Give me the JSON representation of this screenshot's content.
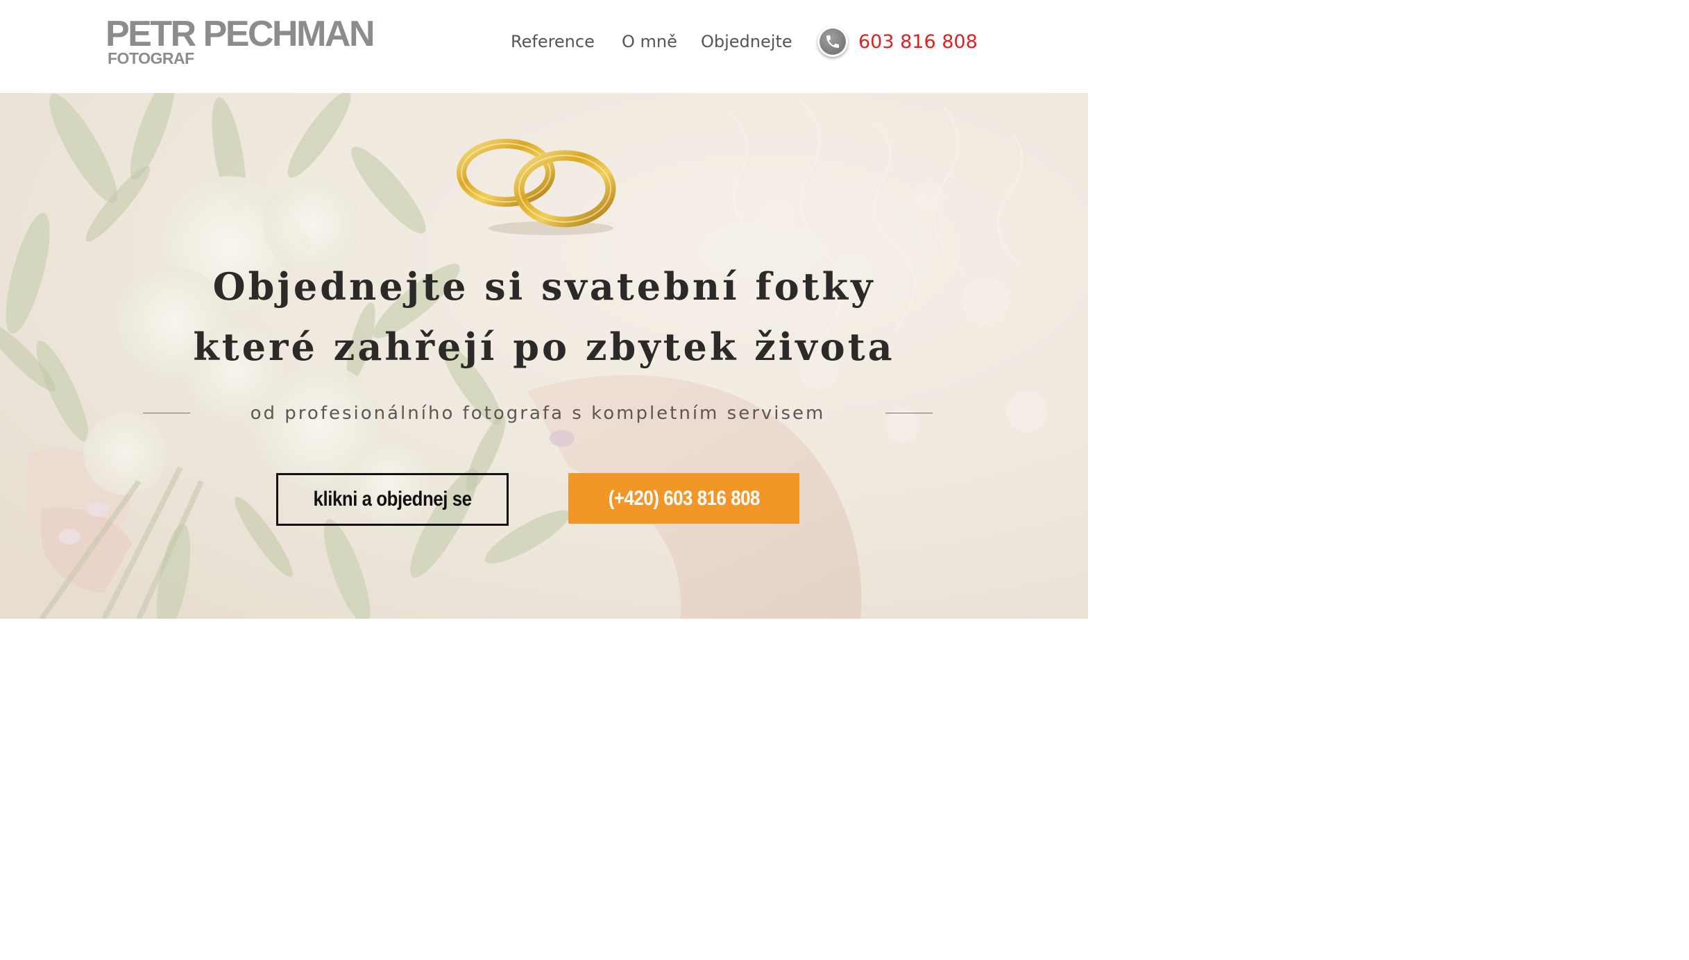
{
  "logo": {
    "name": "PETR PECHMAN",
    "subtitle": "FOTOGRAF"
  },
  "nav": {
    "items": [
      {
        "label": "Reference"
      },
      {
        "label": "O mně"
      },
      {
        "label": "Objednejte"
      }
    ],
    "phone_icon": "phone-icon",
    "phone": "603 816 808"
  },
  "hero": {
    "headline_line1": "Objednejte si svatební fotky",
    "headline_line2": "které zahřejí po zbytek života",
    "subheadline": "od profesionálního fotografa s kompletním servisem",
    "cta_button": "klikni a objednej se",
    "phone_button": "(+420) 603 816 808"
  },
  "colors": {
    "accent_orange": "#f29628",
    "phone_red": "#e0201f",
    "logo_gray": "#8c8c8c",
    "nav_text": "#555555",
    "headline_text": "#2c2a28"
  }
}
